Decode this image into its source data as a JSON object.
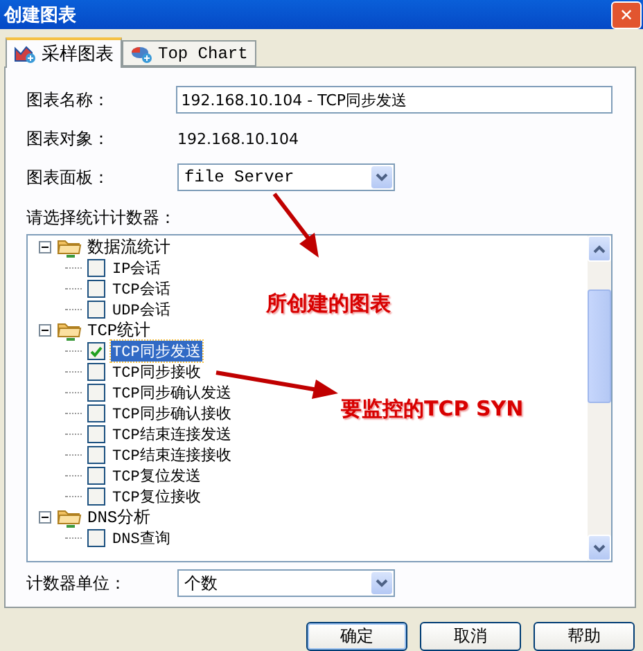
{
  "window": {
    "title": "创建图表",
    "close": "✕"
  },
  "tabs": [
    {
      "label": "采样图表",
      "selected": true
    },
    {
      "label": "Top Chart",
      "selected": false
    }
  ],
  "form": {
    "chart_name": {
      "label": "图表名称：",
      "value": "192.168.10.104 - TCP同步发送"
    },
    "chart_object": {
      "label": "图表对象：",
      "value": "192.168.10.104"
    },
    "chart_panel": {
      "label": "图表面板：",
      "value": "file Server"
    },
    "counters_label": "请选择统计计数器：",
    "counter_unit": {
      "label": "计数器单位：",
      "value": "个数"
    }
  },
  "tree": [
    {
      "label": "数据流统计",
      "expanded": true,
      "children": [
        {
          "label": "IP会话",
          "checked": false,
          "selected": false
        },
        {
          "label": "TCP会话",
          "checked": false,
          "selected": false
        },
        {
          "label": "UDP会话",
          "checked": false,
          "selected": false
        }
      ]
    },
    {
      "label": "TCP统计",
      "expanded": true,
      "children": [
        {
          "label": "TCP同步发送",
          "checked": true,
          "selected": true
        },
        {
          "label": "TCP同步接收",
          "checked": false,
          "selected": false
        },
        {
          "label": "TCP同步确认发送",
          "checked": false,
          "selected": false
        },
        {
          "label": "TCP同步确认接收",
          "checked": false,
          "selected": false
        },
        {
          "label": "TCP结束连接发送",
          "checked": false,
          "selected": false
        },
        {
          "label": "TCP结束连接接收",
          "checked": false,
          "selected": false
        },
        {
          "label": "TCP复位发送",
          "checked": false,
          "selected": false
        },
        {
          "label": "TCP复位接收",
          "checked": false,
          "selected": false
        }
      ]
    },
    {
      "label": "DNS分析",
      "expanded": true,
      "children": [
        {
          "label": "DNS查询",
          "checked": false,
          "selected": false
        }
      ]
    }
  ],
  "annotations": [
    {
      "text": "所创建的图表"
    },
    {
      "text": "要监控的TCP SYN"
    }
  ],
  "buttons": [
    {
      "label": "确定",
      "default": true
    },
    {
      "label": "取消",
      "default": false
    },
    {
      "label": "帮助",
      "default": false
    }
  ]
}
